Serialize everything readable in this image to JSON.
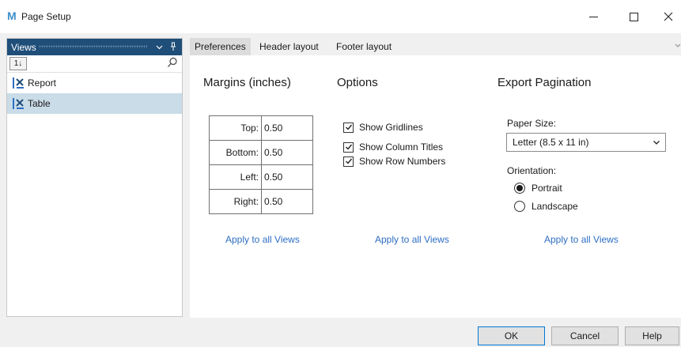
{
  "window": {
    "app_logo": "M",
    "title": "Page Setup",
    "close_glyph": "✕"
  },
  "views_panel": {
    "title": "Views",
    "dropdown_glyph": "⌄",
    "pin_glyph": "ᚁ",
    "sort_label": "1↓",
    "search_value": "",
    "search_placeholder": "",
    "items": [
      {
        "label": "Report",
        "icon": "view-icon",
        "selected": false
      },
      {
        "label": "Table",
        "icon": "view-icon",
        "selected": true
      }
    ]
  },
  "tabs": [
    {
      "label": "Preferences",
      "active": true
    },
    {
      "label": "Header layout",
      "active": false
    },
    {
      "label": "Footer layout",
      "active": false
    }
  ],
  "margins": {
    "title": "Margins (inches)",
    "rows": [
      {
        "label": "Top:",
        "value": "0.50"
      },
      {
        "label": "Bottom:",
        "value": "0.50"
      },
      {
        "label": "Left:",
        "value": "0.50"
      },
      {
        "label": "Right:",
        "value": "0.50"
      }
    ],
    "apply_label": "Apply to all Views"
  },
  "options": {
    "title": "Options",
    "checkboxes": [
      {
        "label": "Show Gridlines",
        "checked": true
      },
      {
        "label": "Show Column Titles",
        "checked": true
      },
      {
        "label": "Show Row Numbers",
        "checked": true
      }
    ],
    "apply_label": "Apply to all Views"
  },
  "export": {
    "title": "Export Pagination",
    "paper_size_label": "Paper Size:",
    "paper_size_value": "Letter (8.5 x 11 in)",
    "orientation_label": "Orientation:",
    "orientations": [
      {
        "label": "Portrait",
        "selected": true
      },
      {
        "label": "Landscape",
        "selected": false
      }
    ],
    "apply_label": "Apply to all Views"
  },
  "buttons": {
    "ok": "OK",
    "cancel": "Cancel",
    "help": "Help"
  },
  "colors": {
    "views_header_bg": "#1f4e79",
    "selected_item_bg": "#c9dce8",
    "link": "#2e6ec2",
    "logo": "#3d8ec9"
  }
}
